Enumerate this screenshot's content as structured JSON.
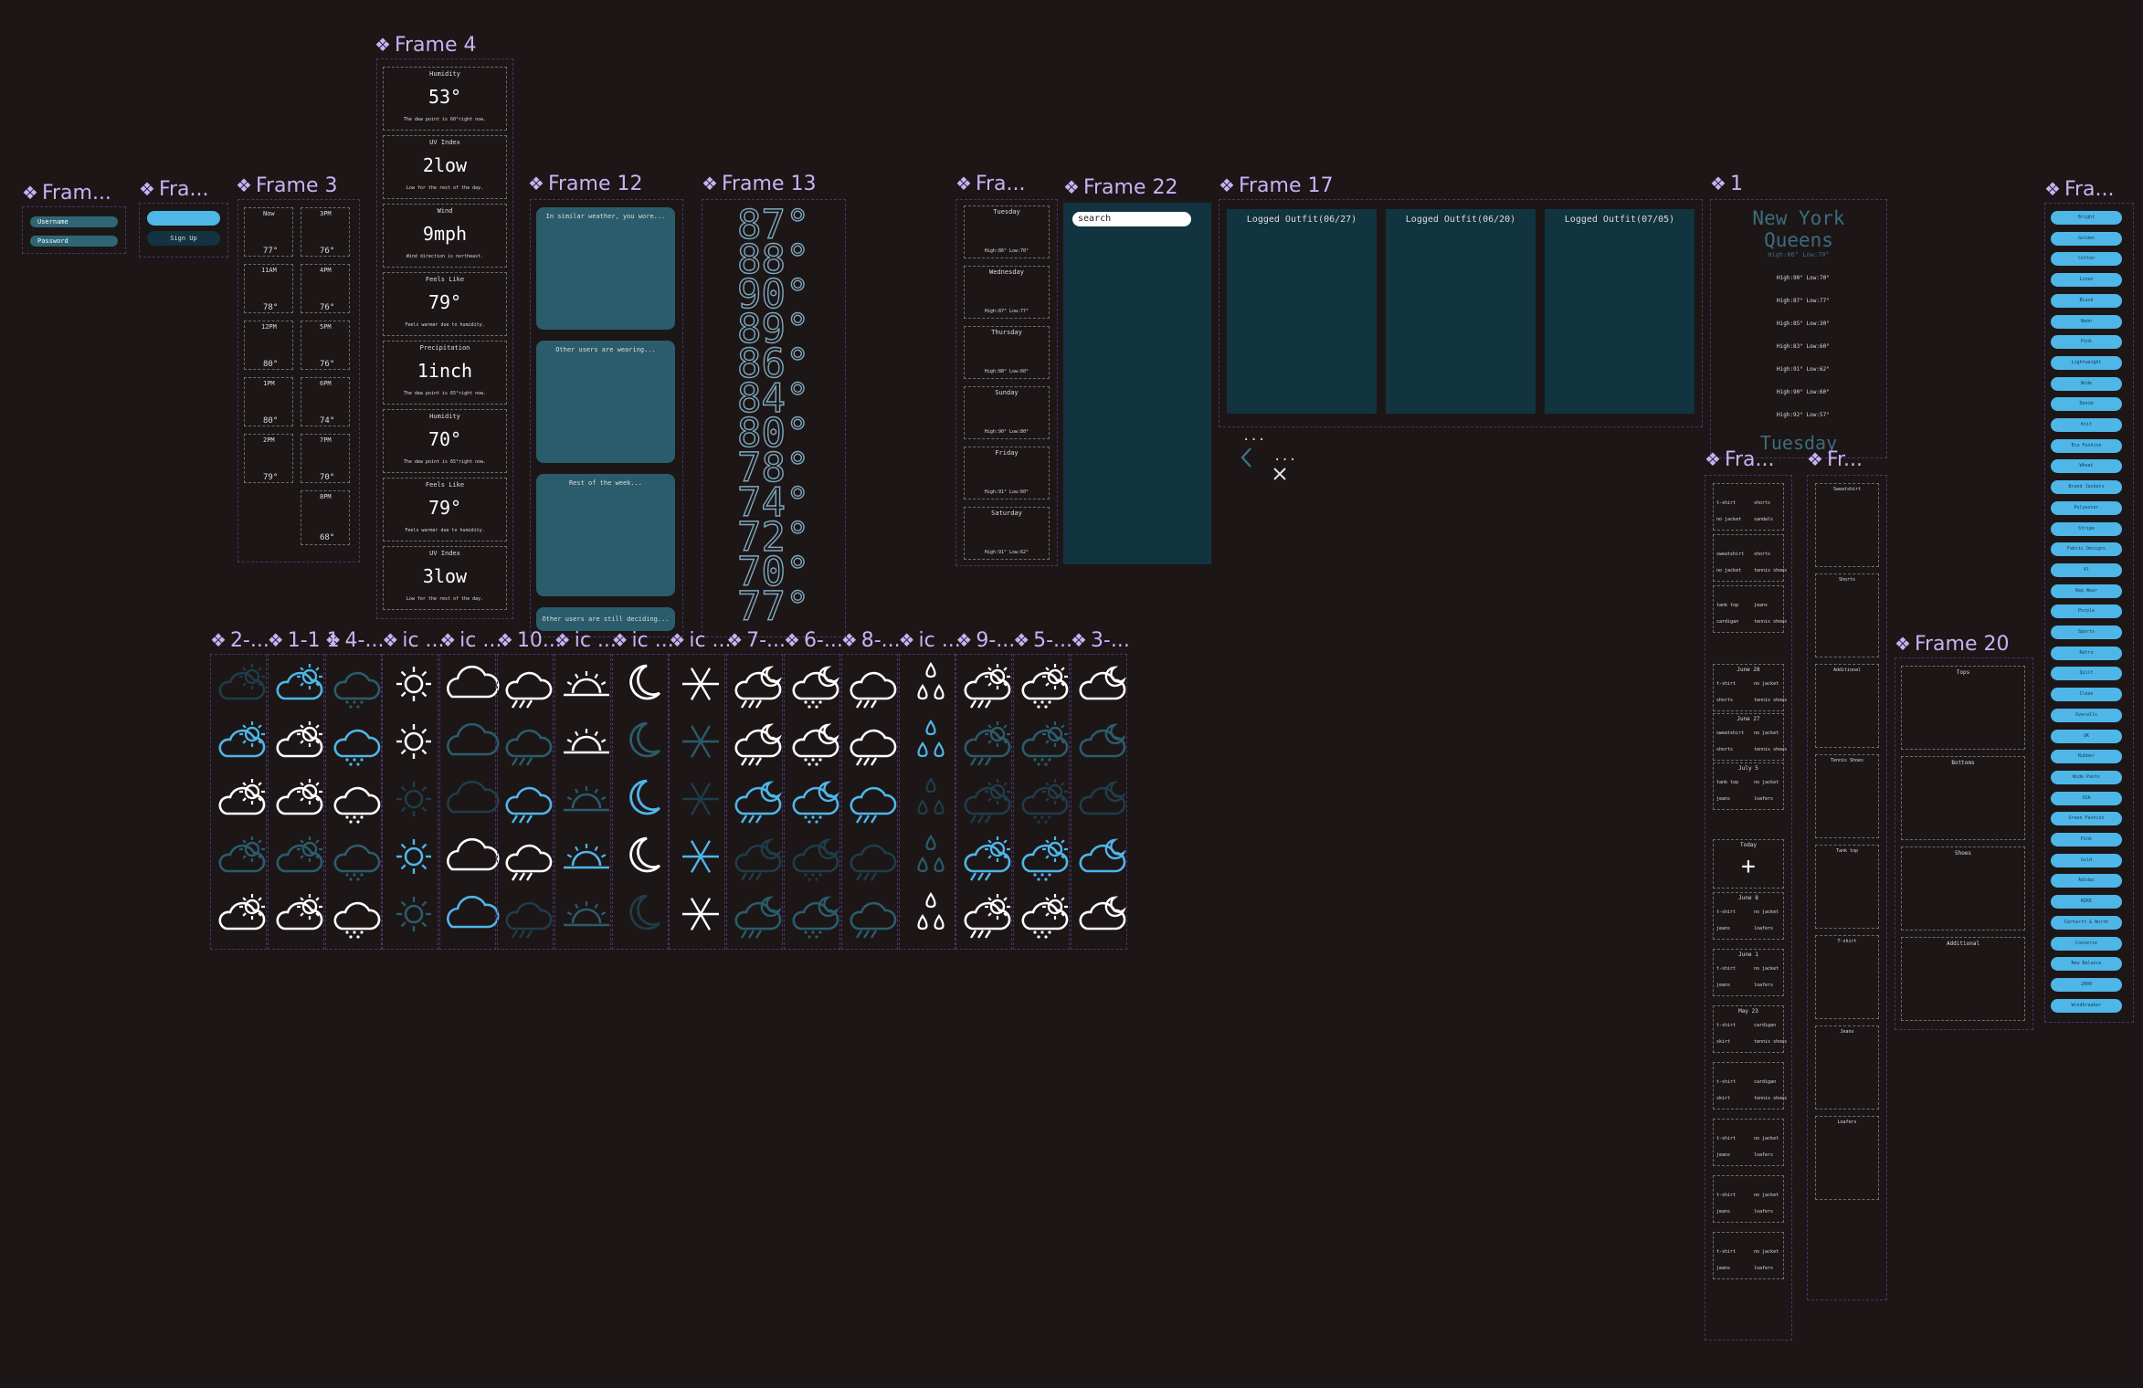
{
  "colors": {
    "bg": "#1c1617",
    "label": "#c9b2f4",
    "frame_border": "#4a3468",
    "accent_blue": "#4fb6e8",
    "teal": "#2b5c6b",
    "dark_teal": "#123340"
  },
  "frames": {
    "f_login": "Fram...",
    "f_signup": "Fra...",
    "f3": "Frame 3",
    "f4": "Frame 4",
    "f12": "Frame 12",
    "f13": "Frame 13",
    "f_days": "Fra...",
    "f22": "Frame 22",
    "f17": "Frame 17",
    "f1": "1",
    "f_right": "Fra...",
    "f_outfits_a": "Fra...",
    "f_outfits_b": "Fr...",
    "f20": "Frame 20"
  },
  "login": {
    "username": "Username",
    "password": "Password"
  },
  "signup": {
    "signup": "Sign Up"
  },
  "hourly": [
    {
      "time": "Now",
      "temp": "77°"
    },
    {
      "time": "3PM",
      "temp": "76°"
    },
    {
      "time": "11AM",
      "temp": "78°"
    },
    {
      "time": "4PM",
      "temp": "76°"
    },
    {
      "time": "12PM",
      "temp": "80°"
    },
    {
      "time": "5PM",
      "temp": "76°"
    },
    {
      "time": "1PM",
      "temp": "80°"
    },
    {
      "time": "6PM",
      "temp": "74°"
    },
    {
      "time": "2PM",
      "temp": "79°"
    },
    {
      "time": "7PM",
      "temp": "70°"
    },
    {
      "time": "8PM",
      "temp": "68°"
    }
  ],
  "details": [
    {
      "label": "Humidity",
      "value": "53°",
      "note": "The dew point is 60°right now."
    },
    {
      "label": "UV Index",
      "value": "2low",
      "note": "Low for the rest of the day."
    },
    {
      "label": "Wind",
      "value": "9mph",
      "note": "Wind direction is northeast."
    },
    {
      "label": "Feels Like",
      "value": "79°",
      "note": "Feels warmer due to humidity."
    },
    {
      "label": "Precipitation",
      "value": "1inch",
      "note": "The dew point is 65°right now."
    },
    {
      "label": "Humidity",
      "value": "70°",
      "note": "The dew point is 65°right now."
    },
    {
      "label": "Feels Like",
      "value": "79°",
      "note": "Feels warmer due to humidity."
    },
    {
      "label": "UV Index",
      "value": "3low",
      "note": "Low for the rest of the day."
    }
  ],
  "suggestions": [
    "In similar weather, you wore...",
    "Other users are wearing...",
    "Rest of the week...",
    "Other users are still deciding..."
  ],
  "temps_big": [
    "87°",
    "88°",
    "90°",
    "89°",
    "86°",
    "84°",
    "80°",
    "78°",
    "74°",
    "72°",
    "70°",
    "77°"
  ],
  "week": [
    {
      "day": "Tuesday",
      "hl": "High:86° Low:70°"
    },
    {
      "day": "Wednesday",
      "hl": "High:87° Low:77°"
    },
    {
      "day": "Thursday",
      "hl": "High:88° Low:60°"
    },
    {
      "day": "Sunday",
      "hl": "High:90° Low:80°"
    },
    {
      "day": "Friday",
      "hl": "High:91° Low:60°"
    },
    {
      "day": "Saturday",
      "hl": "High:91° Low:62°"
    }
  ],
  "search": {
    "placeholder": "search"
  },
  "logged": [
    "Logged Outfit(06/27)",
    "Logged Outfit(06/20)",
    "Logged Outfit(07/05)"
  ],
  "nav": {
    "ellipsis_a": "...",
    "ellipsis_b": "..."
  },
  "city": {
    "city": "New York",
    "borough": "Queens",
    "today_hl": "High:86° Low:70°",
    "days": [
      "High:90° Low:70°",
      "High:87° Low:77°",
      "High:85° Low:30°",
      "High:83° Low:60°",
      "High:91° Low:62°",
      "High:90° Low:60°",
      "High:92° Low:57°"
    ],
    "footer": "Tuesday"
  },
  "icon_cols": [
    "2-...",
    "1-1 1",
    "4-...",
    "ic ...",
    "ic ...",
    "10...",
    "ic ...",
    "ic ...",
    "ic ...",
    "7-...",
    "6-...",
    "8-...",
    "ic ...",
    "9-...",
    "5-...",
    "3-..."
  ],
  "outfit_log": [
    {
      "title": "",
      "items": [
        "t-shirt",
        "shorts",
        "no jacket",
        "sandals"
      ]
    },
    {
      "title": "",
      "items": [
        "sweatshirt",
        "shorts",
        "no jacket",
        "tennis shoes"
      ]
    },
    {
      "title": "",
      "items": [
        "tank top",
        "jeans",
        "cardigan",
        "tennis shoes"
      ]
    },
    {
      "title": "June 28",
      "items": [
        "t-shirt",
        "no jacket",
        "shorts",
        "tennis shoes"
      ]
    },
    {
      "title": "June 27",
      "items": [
        "sweatshirt",
        "no jacket",
        "shorts",
        "tennis shoes"
      ]
    },
    {
      "title": "July 5",
      "items": [
        "tank top",
        "no jacket",
        "jeans",
        "loafers"
      ]
    },
    {
      "title": "June 8",
      "items": [
        "t-shirt",
        "no jacket",
        "jeans",
        "loafers"
      ]
    },
    {
      "title": "June 1",
      "items": [
        "t-shirt",
        "no jacket",
        "jeans",
        "loafers"
      ]
    },
    {
      "title": "May 23",
      "items": [
        "t-shirt",
        "cardigan",
        "skirt",
        "tennis shoes"
      ]
    },
    {
      "title": "",
      "items": [
        "t-shirt",
        "cardigan",
        "skirt",
        "tennis shoes"
      ]
    },
    {
      "title": "",
      "items": [
        "t-shirt",
        "no jacket",
        "jeans",
        "loafers"
      ]
    },
    {
      "title": "",
      "items": [
        "t-shirt",
        "no jacket",
        "jeans",
        "loafers"
      ]
    },
    {
      "title": "",
      "items": [
        "t-shirt",
        "no jacket",
        "jeans",
        "loafers"
      ]
    }
  ],
  "today": {
    "label": "Today",
    "plus": "+"
  },
  "clothing_types": [
    "Sweatshirt",
    "Shorts",
    "Additional",
    "Tennis Shoes",
    "Tank top",
    "T-shirt",
    "Jeans",
    "Loafers"
  ],
  "categories": [
    "Tops",
    "Bottoms",
    "Shoes",
    "Additional"
  ],
  "tags": [
    "Bright",
    "Golden",
    "Cotton",
    "Linen",
    "Black",
    "Neon",
    "Pink",
    "Lightweight",
    "Wide",
    "Denim",
    "Knit",
    "Eco Fashion",
    "Wheat",
    "Brand Jackets",
    "Polyester",
    "Stripe",
    "Fabric Designs",
    "Al",
    "Rep Wear",
    "Purple",
    "Sports",
    "Retro",
    "Quilt",
    "Clean",
    "Overalls",
    "UK",
    "Rubber",
    "Wide Pants",
    "USA",
    "Green Fashion",
    "Pink",
    "Gold",
    "Adidas",
    "NIKE",
    "Carhartt & North",
    "Converse",
    "New Balance",
    "2000",
    "Windbreaker"
  ]
}
